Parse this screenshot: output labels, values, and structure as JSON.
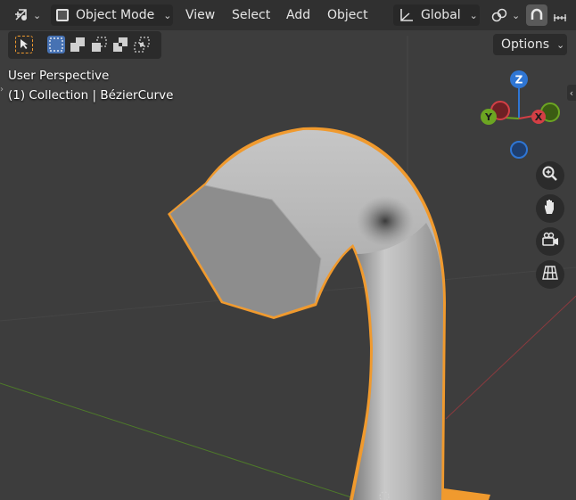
{
  "header": {
    "editor_type_icon": "cursor-transform-icon",
    "mode_label": "Object Mode",
    "menus": [
      "View",
      "Select",
      "Add",
      "Object"
    ],
    "orientation_label": "Global",
    "pivot_icon": "link-chain-icon",
    "snap_icon": "magnet-icon",
    "snap_increment_icon": "snap-increment-icon"
  },
  "toolbar": {
    "options_label": "Options",
    "select_tool_icon": "select-box-cursor-icon",
    "modes": [
      "select-new-icon",
      "select-extend-icon",
      "select-subtract-icon",
      "select-difference-icon",
      "select-intersect-icon"
    ]
  },
  "overlay": {
    "view_name": "User Perspective",
    "collection_info": "(1) Collection | BézierCurve"
  },
  "gizmo": {
    "z_label": "Z",
    "y_label": "Y",
    "x_label": "X",
    "colors": {
      "x": "#d33f45",
      "y": "#6ca522",
      "z": "#2f76d4",
      "x_neg": "#6e2024",
      "y_neg": "#3b5c13"
    }
  },
  "nav_buttons": [
    "zoom-icon",
    "hand-pan-icon",
    "camera-icon",
    "grid-ortho-icon"
  ],
  "colors": {
    "background": "#3d3d3d",
    "header": "#303030",
    "selection_outline": "#f09a2e",
    "accent": "#4772b3"
  }
}
